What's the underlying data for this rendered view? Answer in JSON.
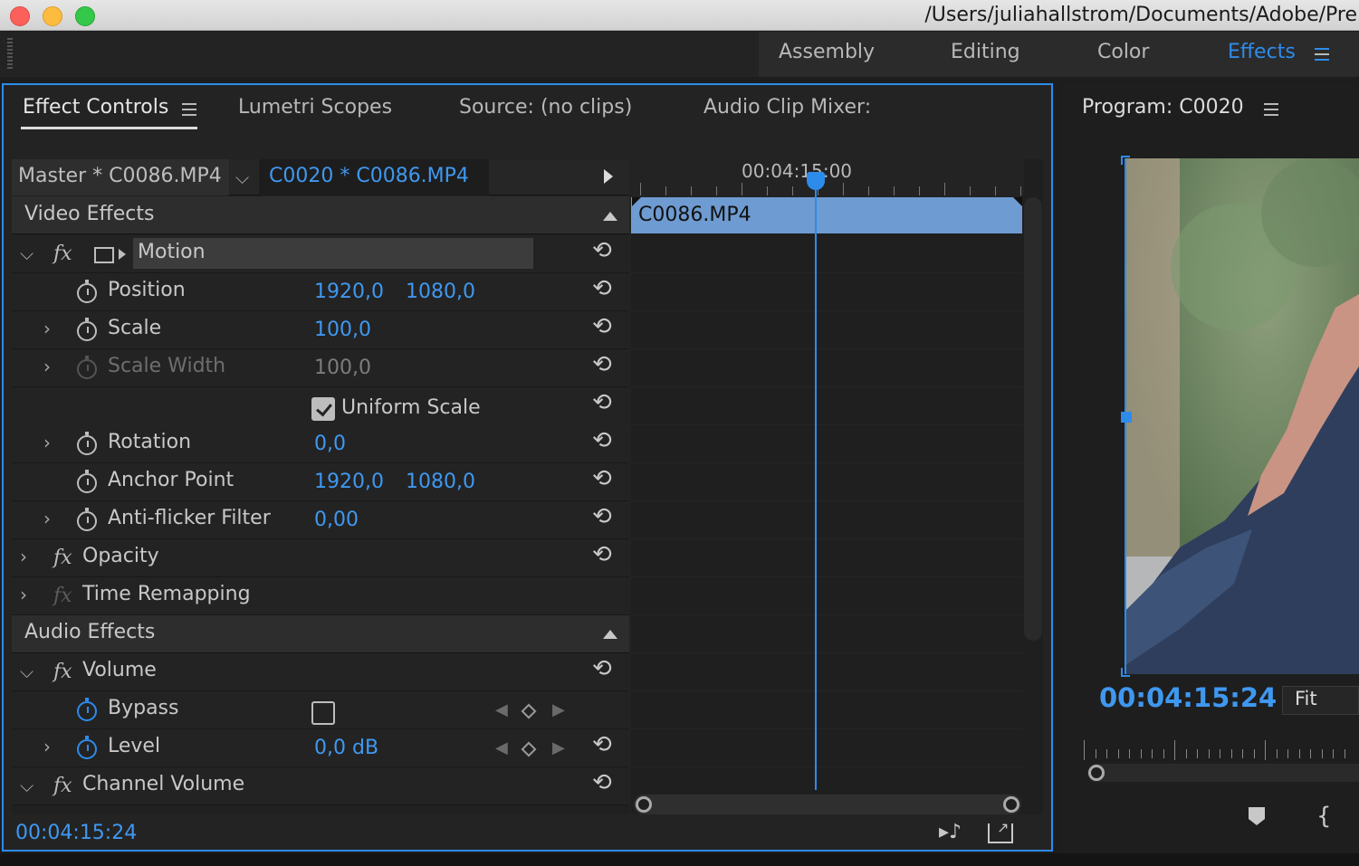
{
  "window": {
    "title_path": "/Users/juliahallstrom/Documents/Adobe/Pre"
  },
  "workspaces": [
    "Assembly",
    "Editing",
    "Color",
    "Effects"
  ],
  "active_workspace": "Effects",
  "effect_panel": {
    "tabs": [
      "Effect Controls",
      "Lumetri Scopes",
      "Source: (no clips)",
      "Audio Clip Mixer:"
    ],
    "active_tab": "Effect Controls",
    "master_clip": "Master * C0086.MP4",
    "sequence_clip": "C0020 * C0086.MP4",
    "timeline_timecode": "00:04:15:00",
    "timeline_clip_name": "C0086.MP4",
    "video_effects_header": "Video Effects",
    "motion_label": "Motion",
    "properties": {
      "position": {
        "label": "Position",
        "x": "1920,0",
        "y": "1080,0"
      },
      "scale": {
        "label": "Scale",
        "value": "100,0"
      },
      "scale_width": {
        "label": "Scale Width",
        "value": "100,0"
      },
      "uniform_scale": {
        "label": "Uniform Scale",
        "checked": true
      },
      "rotation": {
        "label": "Rotation",
        "value": "0,0"
      },
      "anchor_point": {
        "label": "Anchor Point",
        "x": "1920,0",
        "y": "1080,0"
      },
      "anti_flicker": {
        "label": "Anti-flicker Filter",
        "value": "0,00"
      }
    },
    "opacity_label": "Opacity",
    "time_remapping_label": "Time Remapping",
    "audio_effects_header": "Audio Effects",
    "volume_label": "Volume",
    "bypass_label": "Bypass",
    "level": {
      "label": "Level",
      "value": "0,0 dB"
    },
    "channel_volume_label": "Channel Volume",
    "current_timecode": "00:04:15:24"
  },
  "program_monitor": {
    "title": "Program: C0020",
    "timecode": "00:04:15:24",
    "zoom": "Fit"
  },
  "colors": {
    "accent": "#2d8ceb",
    "clip": "#6e9bd1"
  }
}
